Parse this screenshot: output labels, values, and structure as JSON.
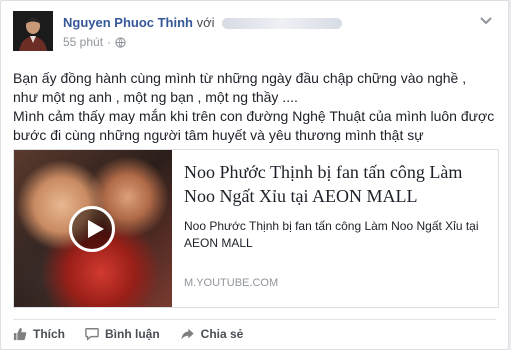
{
  "post": {
    "author_name": "Nguyen Phuoc Thinh",
    "author_with": "với",
    "time": "55 phút",
    "privacy_icon": "globe-icon",
    "lines": [
      "Bạn ấy đồng hành cùng mình từ những ngày đầu chập chững vào nghề ,",
      "như một ng anh , một ng bạn , một ng thầy ....",
      "Mình cảm thấy may mắn khi trên con đường Nghệ Thuật của mình luôn được",
      "bước đi cùng những người tâm huyết và yêu thương mình thật sự"
    ]
  },
  "link": {
    "title": "Noo Phước Thịnh bị fan tấn công Làm Noo Ngất Xỉu tại AEON MALL",
    "description": "Noo Phước Thịnh bị fan tấn công Làm Noo Ngất Xỉu tại AEON MALL",
    "domain": "M.YOUTUBE.COM",
    "thumbnail_icon": "play-icon"
  },
  "actions": {
    "like": "Thích",
    "comment": "Bình luận",
    "share": "Chia sẻ"
  },
  "colors": {
    "author_link": "#365899",
    "secondary_text": "#90949c",
    "border": "#dddfe2"
  }
}
